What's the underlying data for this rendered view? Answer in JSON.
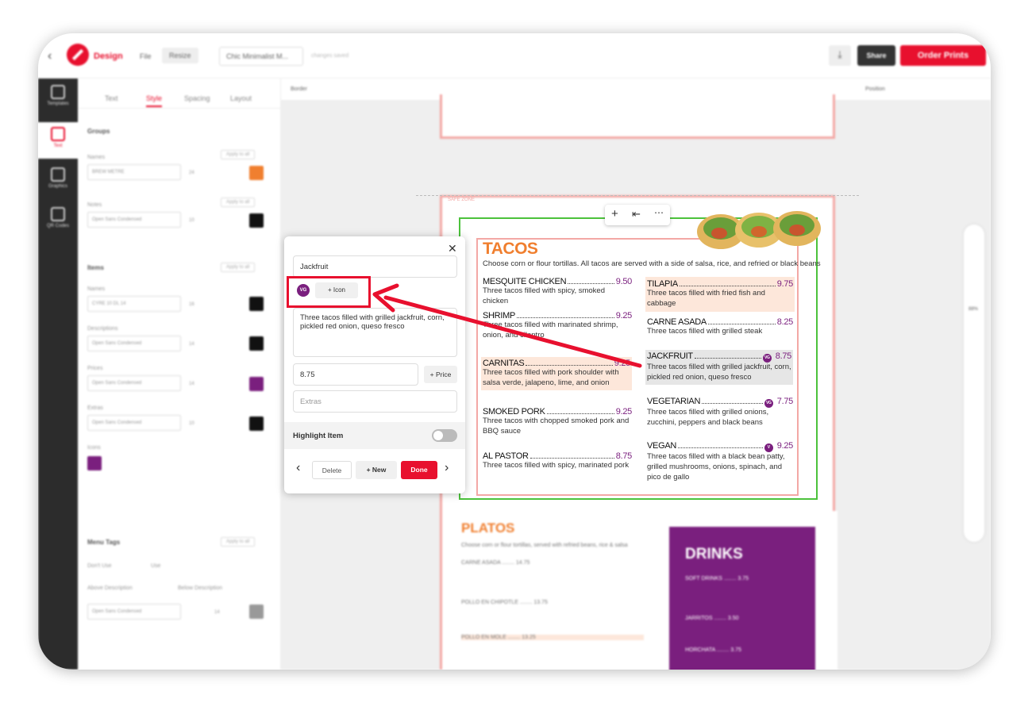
{
  "app": {
    "brand": "Design",
    "menu_file": "File",
    "menu_resize": "Resize",
    "doc_name": "Chic Minimalist M...",
    "saved_status": "changes saved",
    "share_label": "Share",
    "order_label": "Order Prints"
  },
  "rail": [
    {
      "label": "Templates"
    },
    {
      "label": "Text"
    },
    {
      "label": "Graphics"
    },
    {
      "label": "QR Codes"
    }
  ],
  "panel": {
    "tabs": [
      "Text",
      "Style",
      "Spacing",
      "Layout"
    ],
    "groups_title": "Groups",
    "names_label": "Names",
    "names_font": "BREW METRE",
    "names_size": "24",
    "notes_label": "Notes",
    "notes_font": "Open Sans Condensed",
    "notes_size": "10",
    "items_title": "Items",
    "item_names_label": "Names",
    "item_names_font": "CYRE 10 DL 14",
    "item_names_size": "16",
    "descriptions_label": "Descriptions",
    "descriptions_font": "Open Sans Condensed",
    "descriptions_size": "14",
    "prices_label": "Prices",
    "prices_font": "Open Sans Condensed",
    "prices_size": "14",
    "extras_label": "Extras",
    "extras_font": "Open Sans Condensed",
    "extras_size": "10",
    "icons_label": "Icons",
    "menu_tags_title": "Menu Tags",
    "dont_use": "Don't Use",
    "use": "Use",
    "above_desc": "Above Description",
    "below_desc": "Below Description",
    "tags_font": "Open Sans Condensed",
    "tags_size": "14",
    "apply_all": "Apply to all"
  },
  "workspace": {
    "toolbar_left": "Border",
    "toolbar_right": "Position",
    "safe_zone": "SAFE ZONE",
    "zoom": "88%"
  },
  "menu": {
    "title": "TACOS",
    "intro": "Choose corn or flour tortillas. All tacos are served with a side of salsa, rice, and refried or black beans",
    "items": [
      {
        "name": "MESQUITE CHICKEN",
        "price": "9.50",
        "desc": "Three tacos filled with spicy, smoked chicken",
        "badge": ""
      },
      {
        "name": "SHRIMP",
        "price": "9.25",
        "desc": "Three tacos filled with marinated shrimp, onion, and cilantro",
        "badge": ""
      },
      {
        "name": "CARNITAS",
        "price": "9.25",
        "desc": "Three tacos filled with pork shoulder with salsa verde, jalapeno, lime, and onion",
        "badge": ""
      },
      {
        "name": "SMOKED PORK",
        "price": "9.25",
        "desc": "Three tacos with chopped smoked pork and BBQ sauce",
        "badge": ""
      },
      {
        "name": "AL PASTOR",
        "price": "8.75",
        "desc": "Three tacos filled with spicy, marinated pork",
        "badge": ""
      },
      {
        "name": "TILAPIA",
        "price": "9.75",
        "desc": "Three tacos filled with fried fish and cabbage",
        "badge": ""
      },
      {
        "name": "CARNE ASADA",
        "price": "8.25",
        "desc": "Three tacos filled with grilled steak",
        "badge": ""
      },
      {
        "name": "JACKFRUIT",
        "price": "8.75",
        "desc": "Three tacos filled with grilled jackfruit, corn, pickled red onion, queso fresco",
        "badge": "VG"
      },
      {
        "name": "VEGETARIAN",
        "price": "7.75",
        "desc": "Three tacos filled with grilled onions, zucchini, peppers and black beans",
        "badge": "VG"
      },
      {
        "name": "VEGAN",
        "price": "9.25",
        "desc": "Three tacos filled with a black bean patty, grilled mushrooms, onions, spinach, and pico de gallo",
        "badge": "V"
      }
    ],
    "platos_title": "PLATOS",
    "platos_intro": "Choose corn or flour tortillas, served with refried beans, rice & salsa",
    "platos_items": [
      "CARNE ASADA ........ 14.75",
      "POLLO EN CHIPOTLE ........ 13.75",
      "POLLO EN MOLE ........ 13.25"
    ],
    "drinks_title": "DRINKS",
    "drinks_items": [
      "SOFT DRINKS ........ 3.75",
      "JARRITOS ........ 3.50",
      "HORCHATA ........ 3.75"
    ]
  },
  "popup": {
    "name_value": "Jackfruit",
    "badge_label": "VG",
    "add_icon_label": "+ Icon",
    "desc_value": "Three tacos filled with grilled jackfruit, corn, pickled red onion, queso fresco",
    "price_value": "8.75",
    "add_price_label": "+ Price",
    "extras_placeholder": "Extras",
    "highlight_label": "Highlight Item",
    "delete_label": "Delete",
    "new_label": "+ New",
    "done_label": "Done"
  },
  "colors": {
    "accent": "#e8102e",
    "menu_orange": "#f07f2f",
    "menu_purple": "#7a1f7e",
    "highlight": "#fde7da"
  }
}
